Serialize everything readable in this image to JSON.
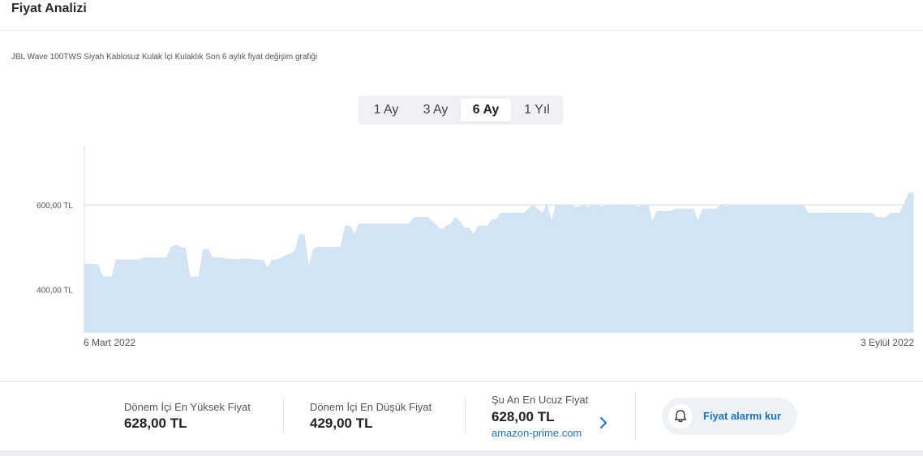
{
  "header": {
    "title": "Fiyat Analizi"
  },
  "subtitle": "JBL Wave 100TWS Siyah Kablosuz Kulak İçi Kulaklık Son 6 aylık fiyat değişim grafiği",
  "tabs": [
    {
      "label": "1 Ay",
      "active": false
    },
    {
      "label": "3 Ay",
      "active": false
    },
    {
      "label": "6 Ay",
      "active": true
    },
    {
      "label": "1 Yıl",
      "active": false
    }
  ],
  "chart_data": {
    "type": "area",
    "title": "",
    "xlabel": "",
    "ylabel": "",
    "x_tick_labels": [
      "6 Mart 2022",
      "3 Eylül 2022"
    ],
    "y_tick_labels": [
      "400,00 TL",
      "600,00 TL"
    ],
    "y_ticks": [
      400,
      600
    ],
    "ylim": [
      300,
      740
    ],
    "grid": true,
    "fill_color": "#d3e5f5",
    "line_color": "#cfe1f2",
    "series": [
      {
        "values": [
          460,
          460,
          460,
          458,
          430,
          430,
          430,
          470,
          470,
          470,
          470,
          470,
          470,
          475,
          475,
          475,
          475,
          475,
          475,
          500,
          505,
          500,
          498,
          430,
          430,
          430,
          495,
          495,
          475,
          475,
          475,
          472,
          472,
          470,
          472,
          472,
          472,
          470,
          470,
          470,
          450,
          470,
          470,
          475,
          480,
          485,
          490,
          530,
          530,
          450,
          495,
          500,
          500,
          500,
          500,
          500,
          500,
          550,
          550,
          530,
          555,
          555,
          555,
          555,
          555,
          555,
          555,
          555,
          555,
          555,
          555,
          555,
          570,
          570,
          570,
          570,
          560,
          550,
          540,
          550,
          555,
          570,
          560,
          545,
          545,
          530,
          550,
          550,
          550,
          565,
          565,
          580,
          580,
          580,
          580,
          580,
          580,
          590,
          600,
          590,
          580,
          600,
          560,
          600,
          600,
          600,
          600,
          595,
          595,
          600,
          595,
          600,
          600,
          595,
          600,
          600,
          600,
          600,
          600,
          600,
          598,
          595,
          600,
          600,
          560,
          585,
          585,
          585,
          585,
          590,
          590,
          590,
          590,
          590,
          560,
          590,
          590,
          590,
          590,
          600,
          595,
          600,
          600,
          600,
          600,
          600,
          600,
          600,
          600,
          600,
          600,
          600,
          600,
          600,
          600,
          600,
          600,
          600,
          580,
          580,
          580,
          580,
          580,
          580,
          580,
          580,
          580,
          580,
          580,
          580,
          580,
          580,
          580,
          570,
          570,
          570,
          580,
          580,
          580,
          600,
          628,
          628
        ]
      }
    ]
  },
  "stats": {
    "highest": {
      "label": "Dönem İçi En Yüksek Fiyat",
      "value": "628,00 TL"
    },
    "lowest": {
      "label": "Dönem İçi En Düşük Fiyat",
      "value": "429,00 TL"
    },
    "cheapest": {
      "label": "Şu An En Ucuz Fiyat",
      "value": "628,00 TL",
      "shop": "amazon-prime.com"
    }
  },
  "alarm_button": {
    "label": "Fiyat alarmı kur",
    "icon": "bell-icon"
  }
}
